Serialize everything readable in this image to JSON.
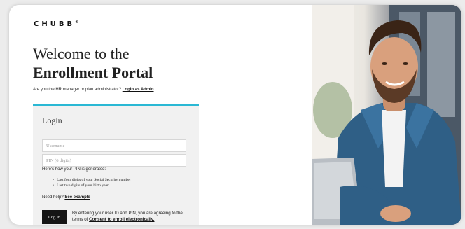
{
  "brand": {
    "logo_text": "CHUBB",
    "trademark": "®"
  },
  "hero": {
    "title_line1": "Welcome to the",
    "title_line2": "Enrollment Portal"
  },
  "admin": {
    "prompt": "Are you the HR manager or plan administrator?",
    "link_label": "Login as Admin"
  },
  "login": {
    "title": "Login",
    "username_placeholder": "Username",
    "pin_placeholder": "PIN (6 digits)",
    "pin_note": "Here's how your PIN is generated:",
    "pin_rules": [
      "Last four digits of your Social Security number",
      "Last two digits of your birth year"
    ],
    "help_prompt": "Need help?",
    "help_link": "See example",
    "button_label": "Log In",
    "consent_text": "By entering your user ID and PIN, you are agreeing to the terms of",
    "consent_link": "Consent to enroll electronically."
  },
  "colors": {
    "accent": "#2ab8d4",
    "button": "#151515"
  },
  "photo": {
    "description_icon": "man-with-laptop-photo"
  }
}
